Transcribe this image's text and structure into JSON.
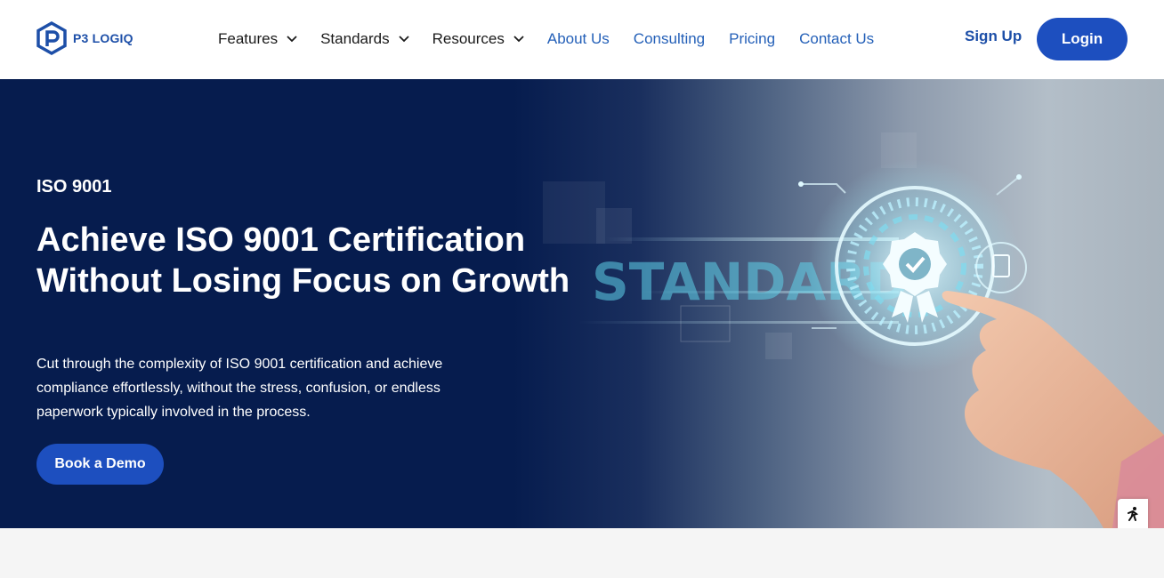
{
  "brand": {
    "name": "P3 LOGIQ",
    "color": "#1d4fa8"
  },
  "nav": {
    "dropdowns": [
      {
        "label": "Features"
      },
      {
        "label": "Standards"
      },
      {
        "label": "Resources"
      }
    ],
    "links": [
      {
        "label": "About Us"
      },
      {
        "label": "Consulting"
      },
      {
        "label": "Pricing"
      },
      {
        "label": "Contact Us"
      }
    ],
    "signup_label": "Sign Up",
    "login_label": "Login"
  },
  "hero": {
    "eyebrow": "ISO 9001",
    "title": "Achieve ISO 9001 Certification Without Losing Focus on Growth",
    "description": "Cut through the complexity of ISO 9001 certification and achieve compliance effortlessly, without the stress, confusion, or endless paperwork typically involved in the process.",
    "cta_label": "Book a Demo",
    "image_word": "STANDARD",
    "background_color": "#061c4e"
  },
  "accessibility": {
    "icon": "accessibility-icon"
  },
  "colors": {
    "primary_button": "#1d4fbf",
    "link": "#2460b8",
    "text_dark": "#1a1a1a"
  }
}
